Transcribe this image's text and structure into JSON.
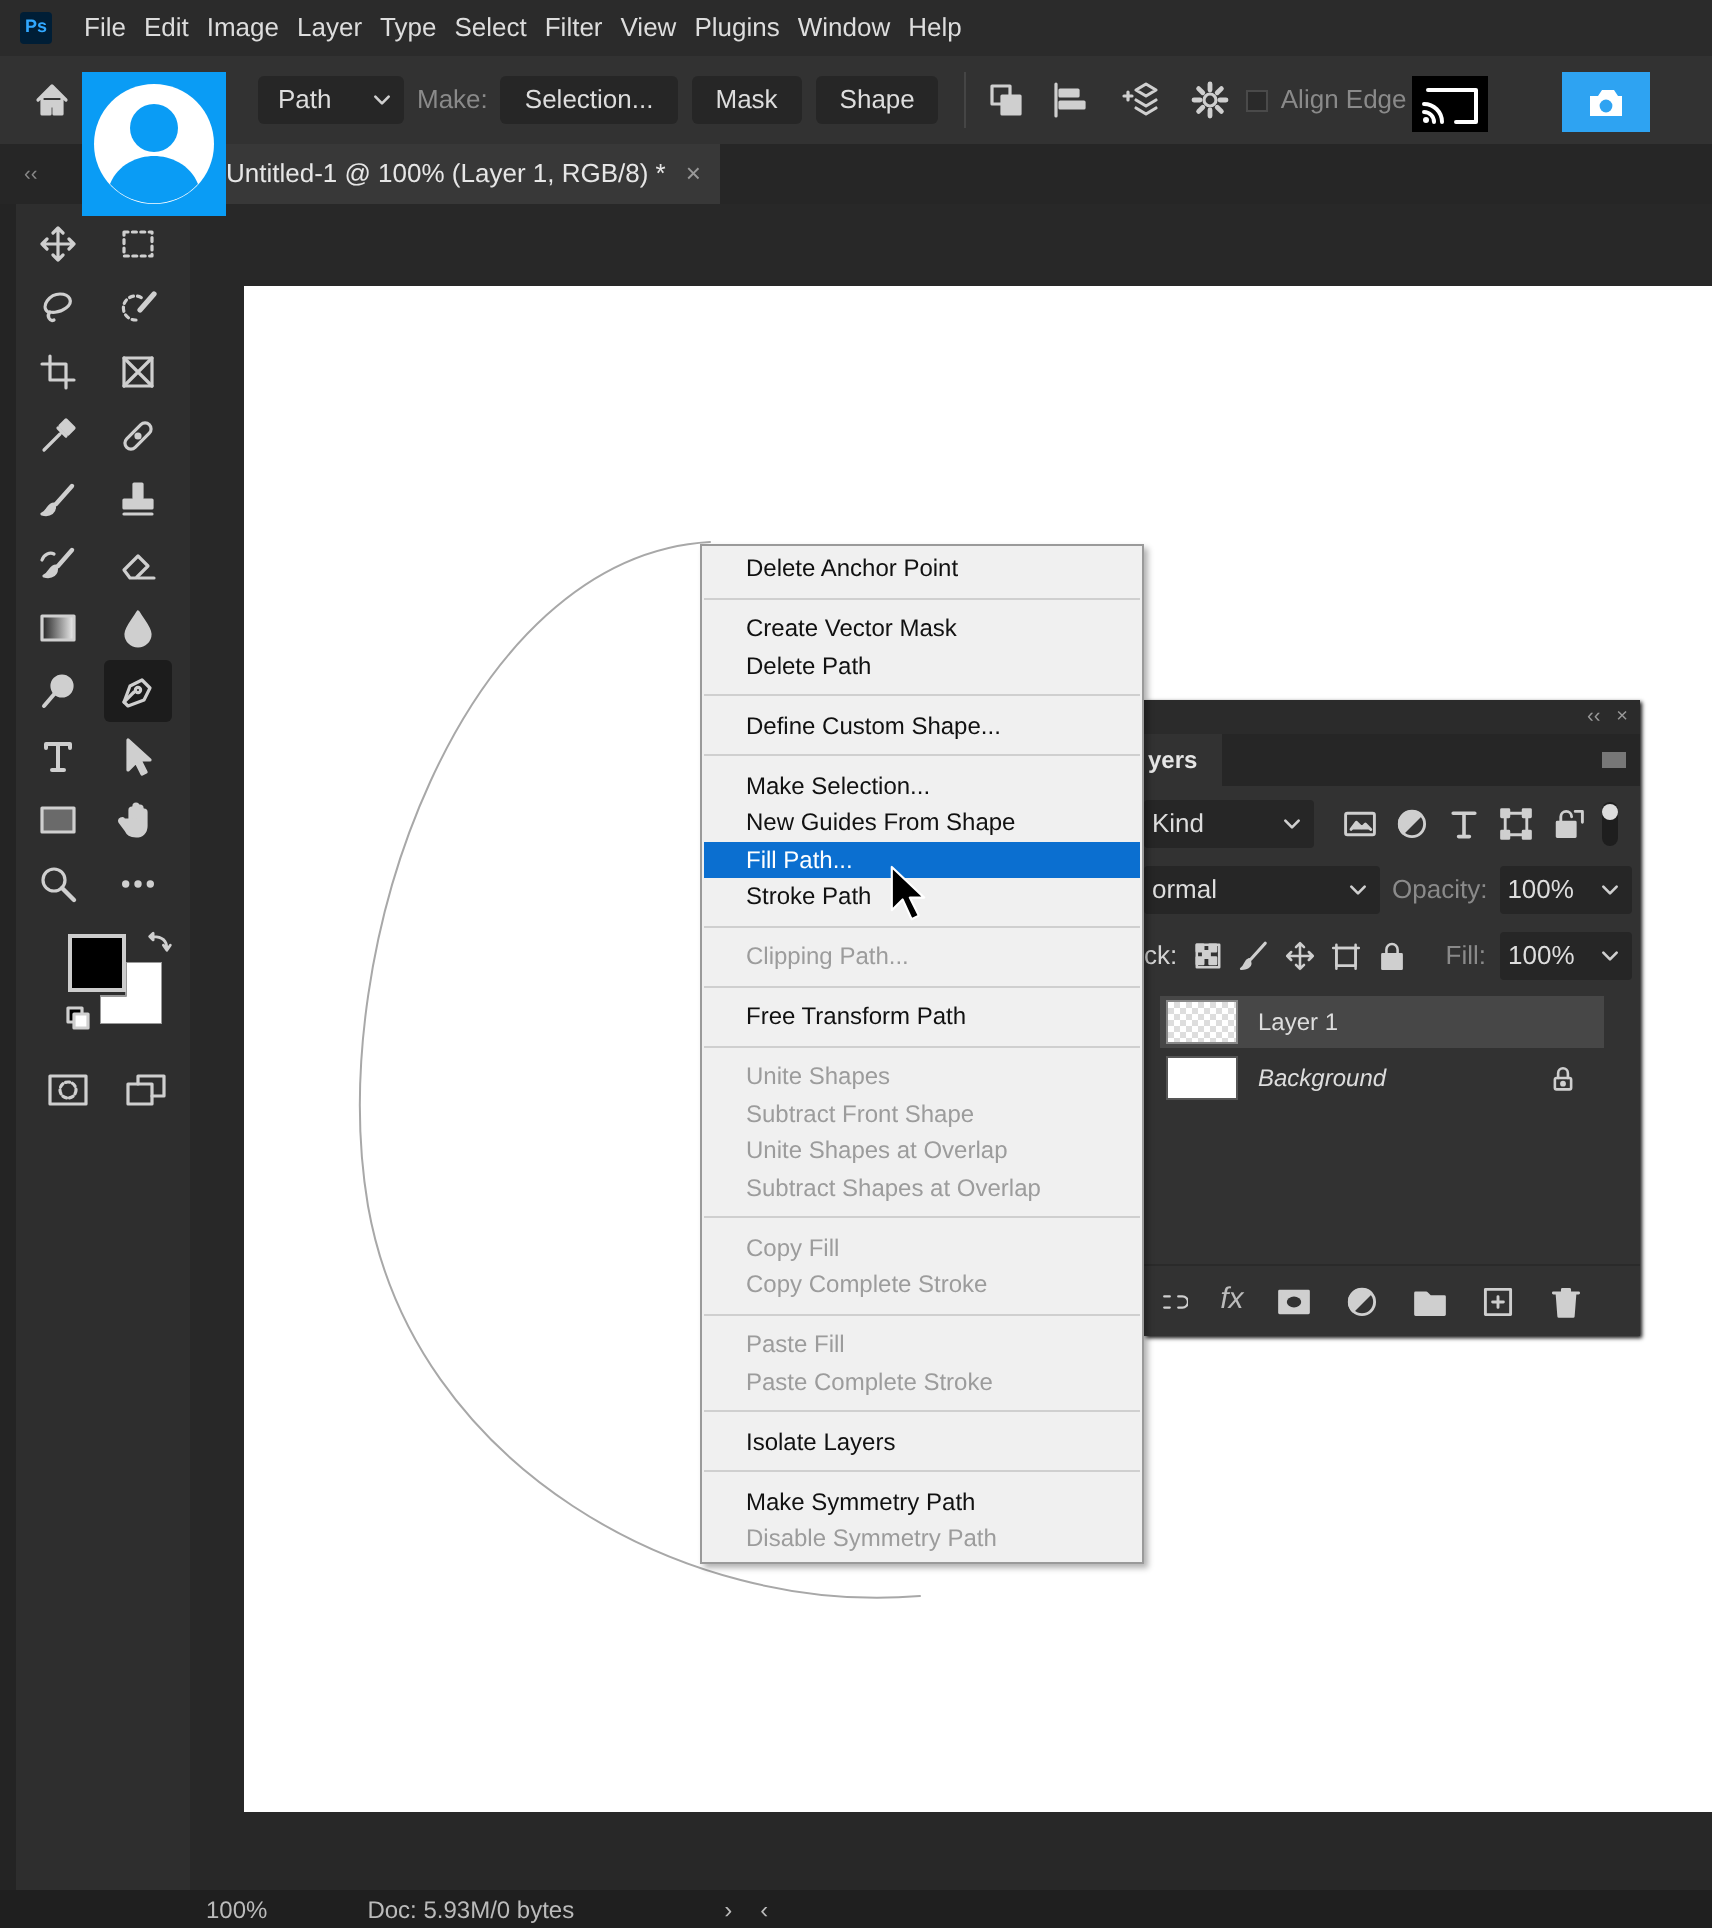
{
  "app_icon": {
    "label": "Ps"
  },
  "menu_bar": [
    "File",
    "Edit",
    "Image",
    "Layer",
    "Type",
    "Select",
    "Filter",
    "View",
    "Plugins",
    "Window",
    "Help"
  ],
  "options_bar": {
    "tool_mode": "Path",
    "make_label": "Make:",
    "buttons": [
      "Selection...",
      "Mask",
      "Shape"
    ],
    "align_edges": {
      "label": "Align Edge",
      "checked": false
    }
  },
  "document_tab": {
    "title": "Untitled-1 @ 100% (Layer 1, RGB/8) *",
    "close": "×"
  },
  "toolbar": {
    "collapse": "‹‹",
    "tools": [
      {
        "selected": false
      },
      {
        "selected": false
      },
      {
        "selected": false
      },
      {
        "selected": false
      },
      {
        "selected": false
      },
      {
        "selected": false
      },
      {
        "selected": false
      },
      {
        "selected": false
      },
      {
        "selected": false
      },
      {
        "selected": false
      },
      {
        "selected": false
      },
      {
        "selected": false
      },
      {
        "selected": false
      },
      {
        "selected": false
      },
      {
        "selected": false
      },
      {
        "selected": true
      },
      {
        "selected": false
      },
      {
        "selected": false
      },
      {
        "selected": false
      },
      {
        "selected": false
      },
      {
        "selected": false
      },
      {
        "selected": false
      }
    ]
  },
  "context_menu": {
    "groups": [
      [
        {
          "label": "Delete Anchor Point",
          "disabled": false,
          "selected": false
        }
      ],
      [
        {
          "label": "Create Vector Mask",
          "disabled": false,
          "selected": false
        },
        {
          "label": "Delete Path",
          "disabled": false,
          "selected": false
        }
      ],
      [
        {
          "label": "Define Custom Shape...",
          "disabled": false,
          "selected": false
        }
      ],
      [
        {
          "label": "Make Selection...",
          "disabled": false,
          "selected": false
        },
        {
          "label": "New Guides From Shape",
          "disabled": false,
          "selected": false
        },
        {
          "label": "Fill Path...",
          "disabled": false,
          "selected": true
        },
        {
          "label": "Stroke Path",
          "disabled": false,
          "selected": false
        }
      ],
      [
        {
          "label": "Clipping Path...",
          "disabled": true,
          "selected": false
        }
      ],
      [
        {
          "label": "Free Transform Path",
          "disabled": false,
          "selected": false
        }
      ],
      [
        {
          "label": "Unite Shapes",
          "disabled": true,
          "selected": false
        },
        {
          "label": "Subtract Front Shape",
          "disabled": true,
          "selected": false
        },
        {
          "label": "Unite Shapes at Overlap",
          "disabled": true,
          "selected": false
        },
        {
          "label": "Subtract Shapes at Overlap",
          "disabled": true,
          "selected": false
        }
      ],
      [
        {
          "label": "Copy Fill",
          "disabled": true,
          "selected": false
        },
        {
          "label": "Copy Complete Stroke",
          "disabled": true,
          "selected": false
        }
      ],
      [
        {
          "label": "Paste Fill",
          "disabled": true,
          "selected": false
        },
        {
          "label": "Paste Complete Stroke",
          "disabled": true,
          "selected": false
        }
      ],
      [
        {
          "label": "Isolate Layers",
          "disabled": false,
          "selected": false
        }
      ],
      [
        {
          "label": "Make Symmetry Path",
          "disabled": false,
          "selected": false
        },
        {
          "label": "Disable Symmetry Path",
          "disabled": true,
          "selected": false
        }
      ]
    ]
  },
  "layers_panel": {
    "collapse": "‹‹",
    "close": "×",
    "tab": "yers",
    "filter": "Kind",
    "blend_mode": "ormal",
    "opacity_label": "Opacity:",
    "opacity": "100%",
    "lock_label": "ck:",
    "fill_label": "Fill:",
    "fill": "100%",
    "footer_fx": "fx",
    "layers": [
      {
        "name": "Layer 1",
        "kind": "layer",
        "selected": true,
        "locked": false
      },
      {
        "name": "Background",
        "kind": "background",
        "selected": false,
        "locked": true
      }
    ]
  },
  "status_bar": {
    "zoom": "100%",
    "doc": "Doc: 5.93M/0 bytes",
    "next": "›",
    "prev": "‹"
  }
}
